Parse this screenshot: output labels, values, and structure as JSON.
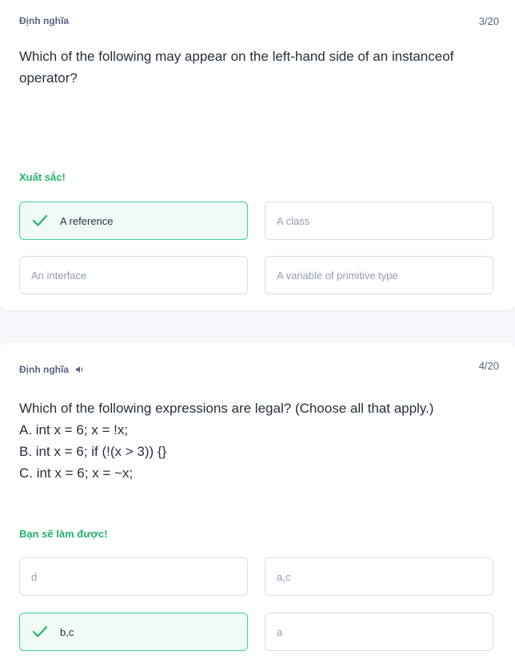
{
  "card1": {
    "term_label": "Định nghĩa",
    "counter": "3/20",
    "question_lines": [
      "Which of the following may appear on the left-hand side of an instanceof operator?"
    ],
    "feedback": "Xuất sắc!",
    "options": [
      {
        "label": "A reference",
        "state": "correct"
      },
      {
        "label": "A class",
        "state": "default"
      },
      {
        "label": "An interface",
        "state": "default"
      },
      {
        "label": "A variable of primitive type",
        "state": "default"
      }
    ]
  },
  "card2": {
    "term_label": "Định nghĩa",
    "counter": "4/20",
    "question_lines": [
      "Which of the following expressions are legal? (Choose all that apply.)",
      "A. int x = 6; x = !x;",
      "B. int x = 6; if (!(x > 3)) {}",
      "C. int x = 6; x = ~x;"
    ],
    "feedback": "Bạn sẽ làm được!",
    "options": [
      {
        "label": "d",
        "state": "default"
      },
      {
        "label": "a,c",
        "state": "default"
      },
      {
        "label": "b,c",
        "state": "correct"
      },
      {
        "label": "a",
        "state": "default"
      }
    ]
  },
  "colors": {
    "correct_text": "#23b26d",
    "correct_border": "#3ccfa0",
    "correct_bg": "#f1fbf6",
    "muted": "#939bb4"
  }
}
